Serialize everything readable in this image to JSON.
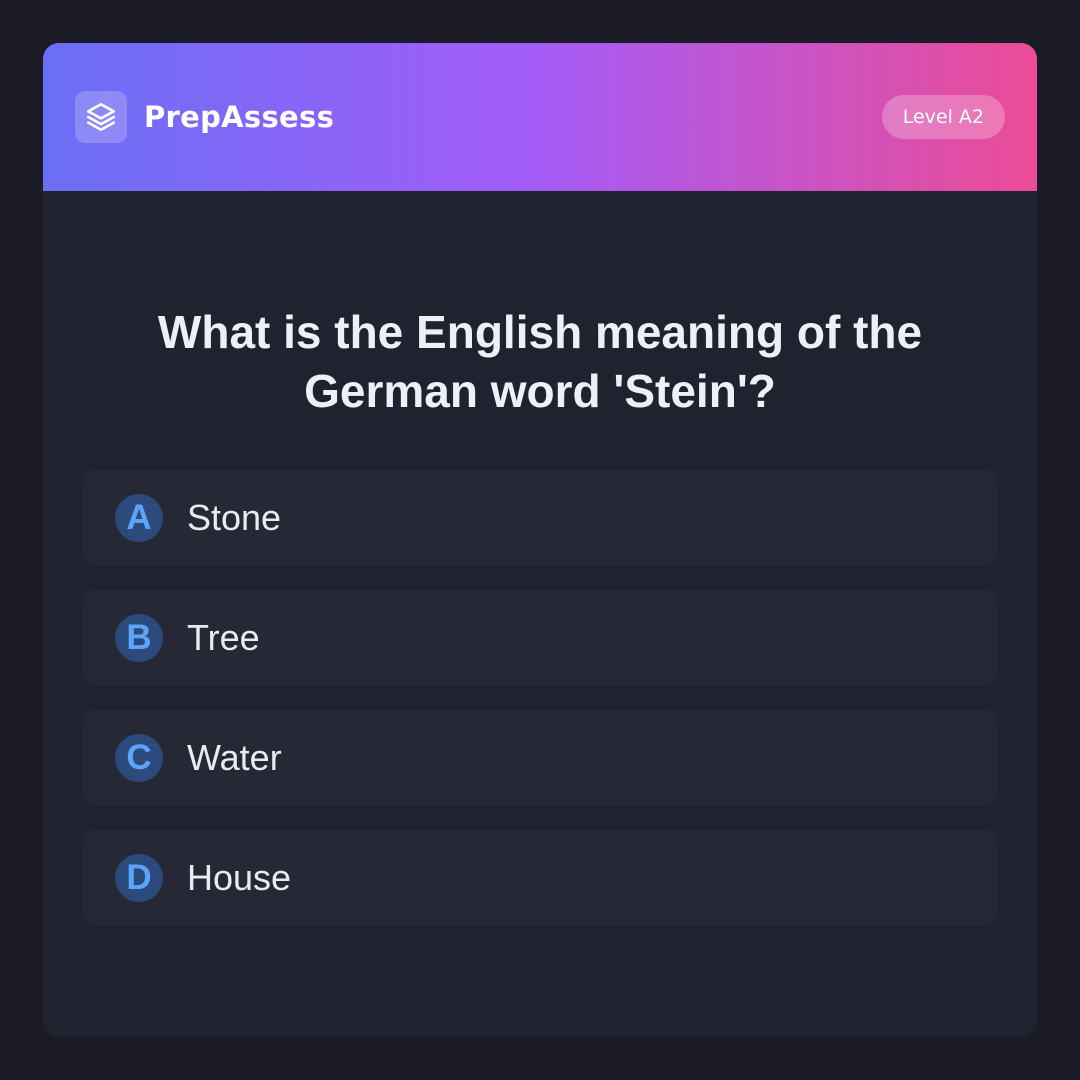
{
  "header": {
    "logo_icon": "layers-icon",
    "app_name": "PrepAssess",
    "level_badge": "Level A2"
  },
  "question": {
    "text": "What is the English meaning of the German word 'Stein'?"
  },
  "options": [
    {
      "letter": "A",
      "text": "Stone"
    },
    {
      "letter": "B",
      "text": "Tree"
    },
    {
      "letter": "C",
      "text": "Water"
    },
    {
      "letter": "D",
      "text": "House"
    }
  ],
  "colors": {
    "background": "#1a1b26",
    "card": "#20222f",
    "option_bg": "#262836",
    "gradient": [
      "#6a6ff5",
      "#a45cf7",
      "#ec4b96"
    ],
    "letter_badge_bg": "#2d4a7d",
    "letter_color": "#5aa5fa"
  }
}
